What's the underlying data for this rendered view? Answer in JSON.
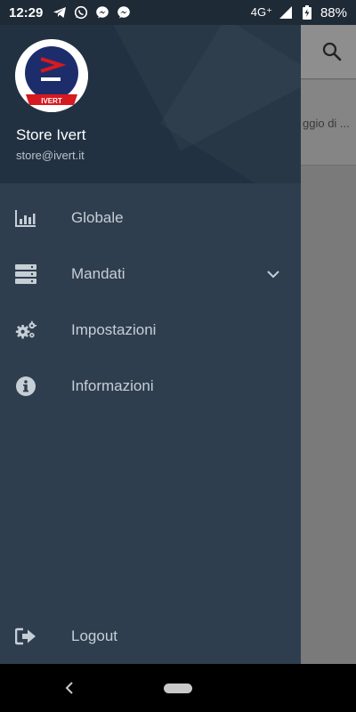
{
  "status_bar": {
    "time": "12:29",
    "network": "4G⁺",
    "battery": "88%",
    "notification_icons": [
      "telegram-icon",
      "whatsapp-icon",
      "messenger-icon",
      "messenger-icon"
    ]
  },
  "background_app": {
    "card_text": "ggio di ..."
  },
  "drawer": {
    "header": {
      "logo_text": "IVERT",
      "name": "Store Ivert",
      "email": "store@ivert.it"
    },
    "items": [
      {
        "label": "Globale",
        "icon": "bar-chart-icon"
      },
      {
        "label": "Mandati",
        "icon": "server-icon",
        "expandable": true
      },
      {
        "label": "Impostazioni",
        "icon": "gears-icon"
      },
      {
        "label": "Informazioni",
        "icon": "info-icon"
      }
    ],
    "logout": {
      "label": "Logout",
      "icon": "sign-out-icon"
    }
  },
  "colors": {
    "drawer_bg": "#2f3e4e",
    "header_bg": "#223141",
    "brand_blue": "#1d2d6b",
    "brand_red": "#d71920"
  }
}
